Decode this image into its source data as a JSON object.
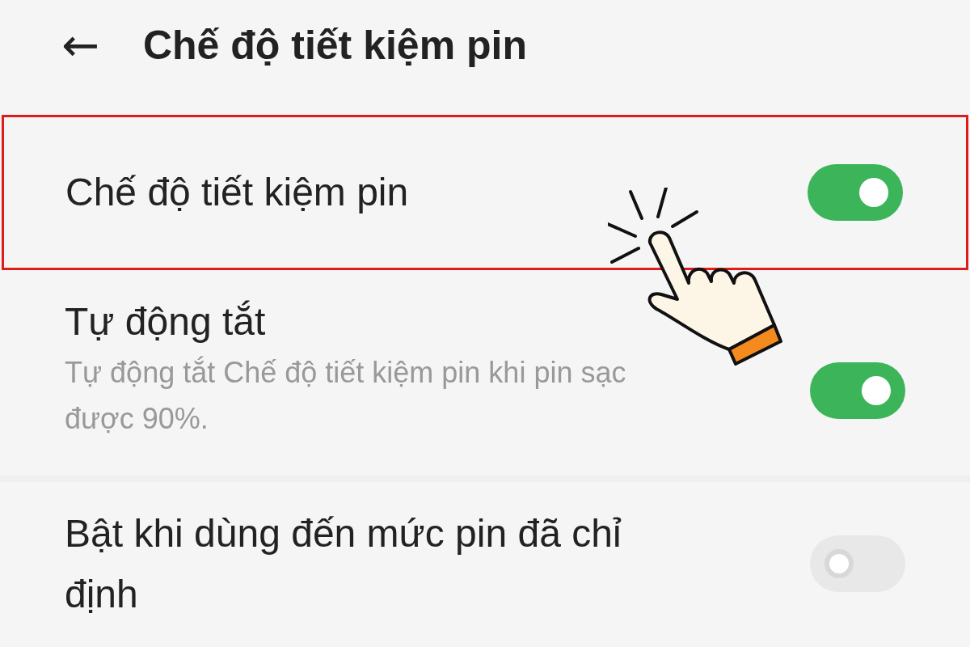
{
  "header": {
    "back": "←",
    "title": "Chế độ tiết kiệm pin"
  },
  "settings": [
    {
      "title": "Chế độ tiết kiệm pin",
      "on": true,
      "highlighted": true
    },
    {
      "title": "Tự động tắt",
      "description": "Tự động tắt Chế độ tiết kiệm pin khi pin sạc được 90%.",
      "on": true,
      "highlighted": false
    },
    {
      "title": "Bật khi dùng đến mức pin đã chỉ định",
      "on": false,
      "highlighted": false
    }
  ]
}
